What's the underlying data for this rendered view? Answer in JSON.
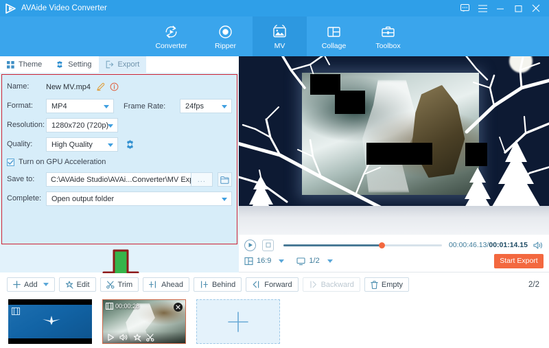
{
  "titlebar": {
    "app_title": "AVAide Video Converter",
    "buttons": [
      {
        "name": "feedback-icon",
        "label": "feedback"
      },
      {
        "name": "menu-icon",
        "label": "menu"
      },
      {
        "name": "minimize-icon",
        "label": "minimize"
      },
      {
        "name": "maximize-icon",
        "label": "maximize"
      },
      {
        "name": "close-icon",
        "label": "close"
      }
    ]
  },
  "topnav": {
    "items": [
      {
        "label": "Converter",
        "icon": "converter-icon",
        "active": false
      },
      {
        "label": "Ripper",
        "icon": "ripper-icon",
        "active": false
      },
      {
        "label": "MV",
        "icon": "mv-icon",
        "active": true
      },
      {
        "label": "Collage",
        "icon": "collage-icon",
        "active": false
      },
      {
        "label": "Toolbox",
        "icon": "toolbox-icon",
        "active": false
      }
    ]
  },
  "tabs": [
    {
      "label": "Theme",
      "icon": "grid-icon",
      "active": false
    },
    {
      "label": "Setting",
      "icon": "gear-icon",
      "active": false
    },
    {
      "label": "Export",
      "icon": "export-icon",
      "active": true
    }
  ],
  "export_form": {
    "name_label": "Name:",
    "name_value": "New MV.mp4",
    "format_label": "Format:",
    "format_value": "MP4",
    "frame_rate_label": "Frame Rate:",
    "frame_rate_value": "24fps",
    "resolution_label": "Resolution:",
    "resolution_value": "1280x720 (720p)",
    "quality_label": "Quality:",
    "quality_value": "High Quality",
    "gpu_label": "Turn on GPU Acceleration",
    "gpu_checked": true,
    "save_to_label": "Save to:",
    "save_to_value": "C:\\AVAide Studio\\AVAi...Converter\\MV Exported",
    "browse_label": "...",
    "complete_label": "Complete:",
    "complete_value": "Open output folder",
    "start_export_label": "Start Export"
  },
  "player": {
    "current_time": "00:00:46.13",
    "separator": "/",
    "total_time": "00:01:14.15",
    "progress_percent": 62,
    "aspect_ratio": "16:9",
    "zoom_level": "1/2",
    "start_export_label": "Start Export"
  },
  "toolbar": {
    "buttons": [
      {
        "label": "Add",
        "icon": "plus-icon",
        "disabled": false,
        "has_caret": true
      },
      {
        "label": "Edit",
        "icon": "edit-icon",
        "disabled": false,
        "has_caret": false
      },
      {
        "label": "Trim",
        "icon": "scissors-icon",
        "disabled": false,
        "has_caret": false
      },
      {
        "label": "Ahead",
        "icon": "ahead-icon",
        "disabled": false,
        "has_caret": false
      },
      {
        "label": "Behind",
        "icon": "behind-icon",
        "disabled": false,
        "has_caret": false
      },
      {
        "label": "Forward",
        "icon": "forward-icon",
        "disabled": false,
        "has_caret": false
      },
      {
        "label": "Backward",
        "icon": "backward-icon",
        "disabled": true,
        "has_caret": false
      },
      {
        "label": "Empty",
        "icon": "trash-icon",
        "disabled": false,
        "has_caret": false
      }
    ],
    "pager": "2/2"
  },
  "thumbnails": [
    {
      "name": "clip-1",
      "selected": false,
      "duration": ""
    },
    {
      "name": "clip-2",
      "selected": true,
      "duration": "00:00:28"
    }
  ],
  "colors": {
    "brand_blue": "#2f9fe8",
    "nav_blue": "#3aa5ec",
    "nav_active": "#2d98e0",
    "panel_bg": "#d7edf9",
    "accent_orange": "#f3683f",
    "highlight_red": "#cc2233",
    "arrow_green": "#36b44a"
  }
}
